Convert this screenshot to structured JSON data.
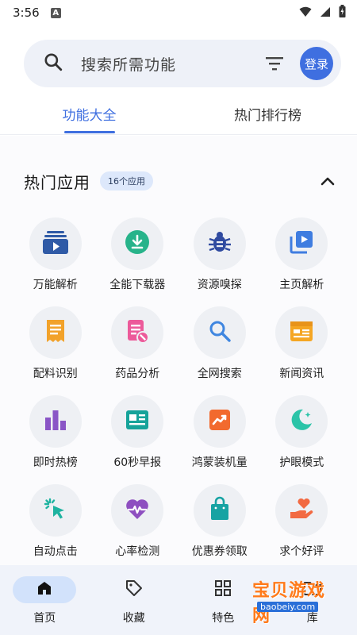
{
  "status_bar": {
    "time": "3:56",
    "notification_letter": "A"
  },
  "search": {
    "placeholder": "搜索所需功能",
    "login_label": "登录"
  },
  "tabs": [
    {
      "label": "功能大全",
      "active": true
    },
    {
      "label": "热门排行榜",
      "active": false
    }
  ],
  "section": {
    "title": "热门应用",
    "badge": "16个应用"
  },
  "apps": [
    {
      "label": "万能解析",
      "icon": "video-stack-icon",
      "color": "#2f5aa6"
    },
    {
      "label": "全能下载器",
      "icon": "download-icon",
      "color": "#27b38a"
    },
    {
      "label": "资源嗅探",
      "icon": "bug-icon",
      "color": "#2f4aa0"
    },
    {
      "label": "主页解析",
      "icon": "play-gallery-icon",
      "color": "#3f7de0"
    },
    {
      "label": "配料识别",
      "icon": "receipt-icon",
      "color": "#f2a22a"
    },
    {
      "label": "药品分析",
      "icon": "medical-doc-icon",
      "color": "#ec5a9a"
    },
    {
      "label": "全网搜索",
      "icon": "search-icon",
      "color": "#3f86e0"
    },
    {
      "label": "新闻资讯",
      "icon": "calendar-news-icon",
      "color": "#f5a623"
    },
    {
      "label": "即时热榜",
      "icon": "bar-chart-icon",
      "color": "#8a55c6"
    },
    {
      "label": "60秒早报",
      "icon": "newspaper-icon",
      "color": "#16a39a"
    },
    {
      "label": "鸿蒙装机量",
      "icon": "trending-up-icon",
      "color": "#f26a2e"
    },
    {
      "label": "护眼模式",
      "icon": "moon-icon",
      "color": "#2bc4a8"
    },
    {
      "label": "自动点击",
      "icon": "cursor-click-icon",
      "color": "#1eb3a0"
    },
    {
      "label": "心率检测",
      "icon": "heart-pulse-icon",
      "color": "#8e4fc0"
    },
    {
      "label": "优惠券领取",
      "icon": "shopping-bag-icon",
      "color": "#17a3a3"
    },
    {
      "label": "求个好评",
      "icon": "hand-heart-icon",
      "color": "#f26a42"
    }
  ],
  "bottom_nav": [
    {
      "label": "首页",
      "icon": "home-icon",
      "active": true
    },
    {
      "label": "收藏",
      "icon": "tag-icon",
      "active": false
    },
    {
      "label": "特色",
      "icon": "grid-icon",
      "active": false
    },
    {
      "label": "库",
      "icon": "folder-icon",
      "active": false
    }
  ],
  "watermark": {
    "text": "宝贝游戏网",
    "url": "baobeiy.com"
  },
  "colors": {
    "accent": "#3f6fe0",
    "nav_bg": "#f0f3fa",
    "active_pill": "#d2e2fb"
  }
}
